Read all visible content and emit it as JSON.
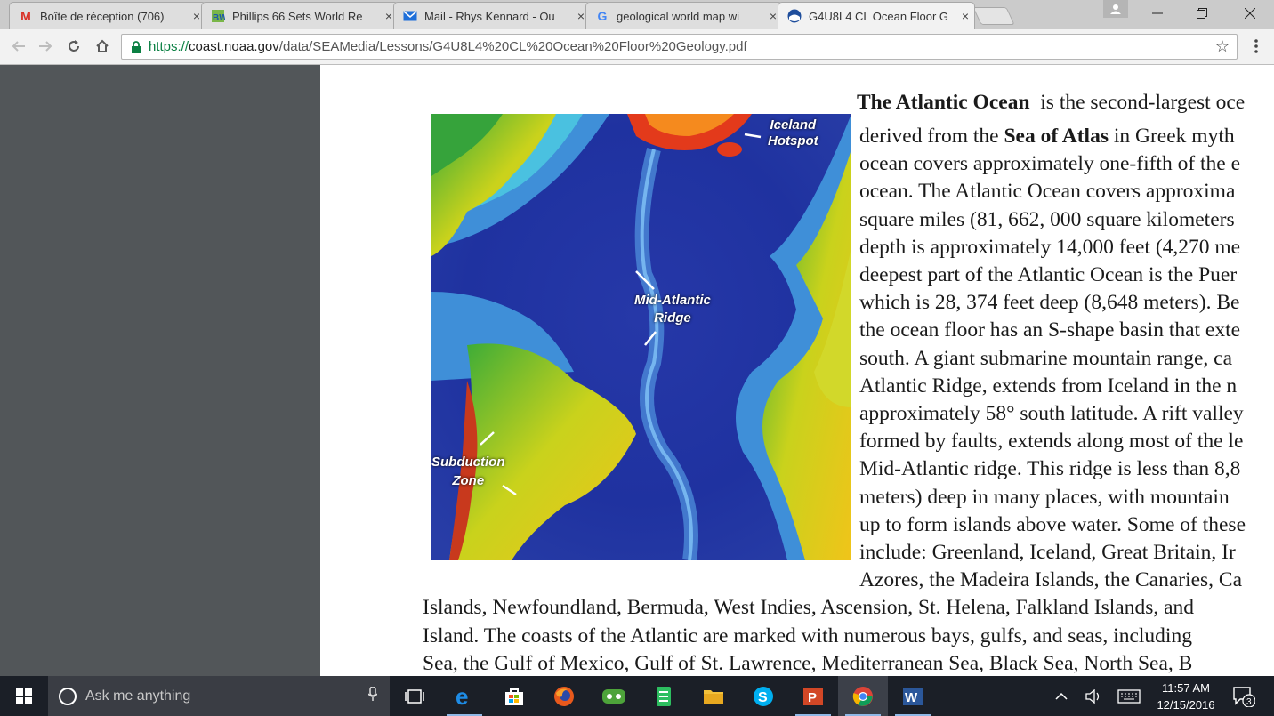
{
  "browser": {
    "tabs": [
      {
        "title": "Boîte de réception (706)",
        "icon": "gmail-icon",
        "active": false
      },
      {
        "title": "Phillips 66 Sets World Re",
        "icon": "bw-icon",
        "active": false
      },
      {
        "title": "Mail - Rhys Kennard - Ou",
        "icon": "mail-icon",
        "active": false
      },
      {
        "title": "geological world map wi",
        "icon": "google-icon",
        "active": false
      },
      {
        "title": "G4U8L4 CL Ocean Floor G",
        "icon": "noaa-icon",
        "active": true
      }
    ],
    "close_glyph": "×",
    "address": {
      "scheme": "https://",
      "host": "coast.noaa.gov",
      "path": "/data/SEAMedia/Lessons/G4U8L4%20CL%20Ocean%20Floor%20Geology.pdf"
    }
  },
  "document": {
    "map_labels": {
      "iceland_hotspot_1": "Iceland",
      "iceland_hotspot_2": "Hotspot",
      "mid_atlantic_1": "Mid-Atlantic",
      "mid_atlantic_2": "Ridge",
      "subduction_1": "Subduction",
      "subduction_2": "Zone"
    },
    "heading_bold": "The Atlantic Ocean",
    "lines": [
      "is the second-largest oce",
      "derived from the",
      "Sea of Atlas",
      "in Greek myth",
      "ocean covers approximately one-fifth of the e",
      "ocean. The Atlantic Ocean covers approxima",
      "square miles (81, 662, 000 square kilometers",
      "depth is approximately 14,000 feet (4,270 me",
      "deepest part of the Atlantic Ocean is the Puer",
      "which is 28, 374 feet deep (8,648 meters). Be",
      "the ocean floor has an S-shape basin that exte",
      "south.  A giant submarine mountain range, ca",
      "Atlantic Ridge, extends from Iceland in the n",
      "approximately 58° south latitude. A rift valley",
      "formed by faults, extends along most of the le",
      "Mid-Atlantic ridge. This ridge is less than 8,8",
      "meters) deep in many places, with mountain",
      "up to form islands above water. Some of these",
      "include: Greenland, Iceland, Great Britain, Ir",
      "Azores, the Madeira Islands, the Canaries, Ca",
      "Islands, Newfoundland, Bermuda, West Indies, Ascension, St. Helena, Falkland Islands, and",
      "Island. The coasts of the Atlantic are marked with numerous bays, gulfs, and seas, including",
      "Sea, the Gulf of Mexico, Gulf of St. Lawrence, Mediterranean Sea, Black Sea, North Sea, B"
    ]
  },
  "taskbar": {
    "search_placeholder": "Ask me anything",
    "time": "11:57 AM",
    "date": "12/15/2016",
    "notification_count": "3",
    "apps": [
      "task-view-icon",
      "edge-icon",
      "store-icon",
      "firefox-icon",
      "groups-icon",
      "evernote-icon",
      "file-explorer-icon",
      "skype-icon",
      "powerpoint-icon",
      "chrome-icon",
      "word-icon"
    ]
  }
}
